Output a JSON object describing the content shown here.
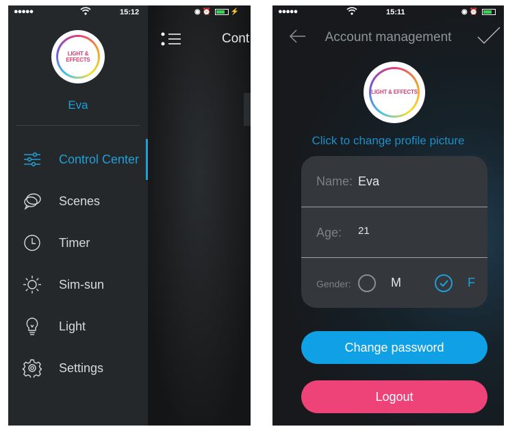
{
  "left_screen": {
    "status": {
      "signal": "●●●●●",
      "wifi_icon": "wifi-icon",
      "time": "15:12"
    },
    "drawer": {
      "avatar_logo_line1": "LIGHT & EFFECTS",
      "username": "Eva",
      "items": [
        {
          "label": "Control Center",
          "icon": "sliders-icon",
          "active": true
        },
        {
          "label": "Scenes",
          "icon": "chat-bubbles-icon",
          "active": false
        },
        {
          "label": "Timer",
          "icon": "clock-icon",
          "active": false
        },
        {
          "label": "Sim-sun",
          "icon": "sun-icon",
          "active": false
        },
        {
          "label": "Light",
          "icon": "bulb-icon",
          "active": false
        },
        {
          "label": "Settings",
          "icon": "gear-icon",
          "active": false
        }
      ]
    },
    "peek": {
      "title": "Cont"
    }
  },
  "right_screen": {
    "status": {
      "signal": "●●●●●",
      "time": "15:11"
    },
    "nav": {
      "title": "Account management"
    },
    "avatar_logo": "LIGHT & EFFECTS",
    "change_picture": "Click to change profile picture",
    "form": {
      "name_label": "Name:",
      "name_value": "Eva",
      "age_label": "Age:",
      "age_value": "21",
      "gender_label": "Gender:",
      "gender_male": "M",
      "gender_female": "F",
      "selected_gender": "F"
    },
    "change_password": "Change password",
    "logout": "Logout"
  },
  "colors": {
    "accent_blue": "#1ea0d8",
    "button_blue": "#0fa0e6",
    "button_pink": "#ee4379",
    "battery_green": "#39d353"
  }
}
